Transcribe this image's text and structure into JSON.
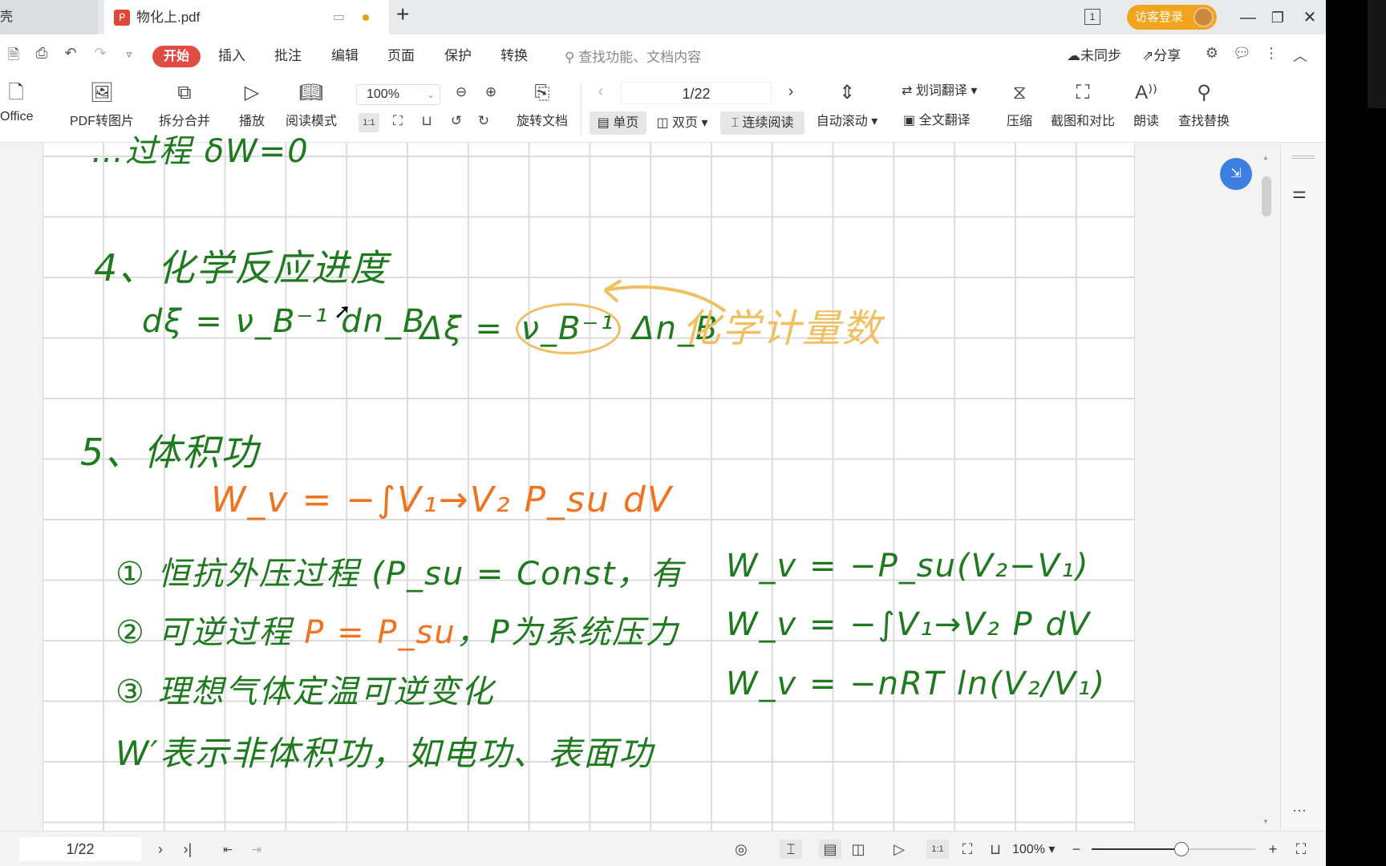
{
  "tabs": {
    "inactive_label": "壳",
    "active_label": "物化上.pdf",
    "pdf_icon": "pdf-file-icon",
    "new_tab": "+"
  },
  "titlebar": {
    "page_count_badge": "1",
    "login_label": "访客登录"
  },
  "menu": {
    "items": [
      "开始",
      "插入",
      "批注",
      "编辑",
      "页面",
      "保护",
      "转换"
    ],
    "search_placeholder": "查找功能、文档内容",
    "sync_label": "未同步",
    "share_label": "分享"
  },
  "toolbar": {
    "office": "Office",
    "pdf_to_image": "PDF转图片",
    "split_merge": "拆分合并",
    "play": "播放",
    "read_mode": "阅读模式",
    "zoom": "100%",
    "rotate_doc": "旋转文档",
    "page_indicator": "1/22",
    "single_page": "单页",
    "double_page": "双页",
    "continuous": "连续阅读",
    "auto_scroll": "自动滚动",
    "word_translate": "划词翻译",
    "full_translate": "全文翻译",
    "compress": "压缩",
    "screenshot_compare": "截图和对比",
    "read_aloud": "朗读",
    "find_replace": "查找替换",
    "actual_size": "1:1"
  },
  "document": {
    "top_partial": "…过程 δW=0",
    "section4_title": "4、化学反应进度",
    "eq_dxi": "dξ = ν_B⁻¹ dn_B",
    "eq_delta_xi_left": "Δξ =",
    "eq_nu": "ν_B⁻¹",
    "eq_delta_n": "Δn_B",
    "annotation": "化学计量数",
    "section5_title": "5、体积功",
    "wv_formula": "W_v = −∫V₁→V₂ P_su dV",
    "items": [
      {
        "text": "① 恒抗外压过程 (P_su = Const，有",
        "formula": "W_v = −P_su(V₂−V₁)"
      },
      {
        "text": "② 可逆过程",
        "highlight": "P = P_su",
        "text2": "，P为系统压力",
        "formula": "W_v = −∫V₁→V₂ P dV"
      },
      {
        "text": "③ 理想气体定温可逆变化",
        "formula": "W_v = −nRT ln(V₂/V₁)"
      }
    ],
    "note": "W′表示非体积功，如电功、表面功",
    "colors": {
      "green": "#1f7a1f",
      "orange": "#f07320",
      "yellow": "#f0c060"
    }
  },
  "statusbar": {
    "page": "1/22",
    "zoom": "100%",
    "zoom_level_percent": 55
  }
}
